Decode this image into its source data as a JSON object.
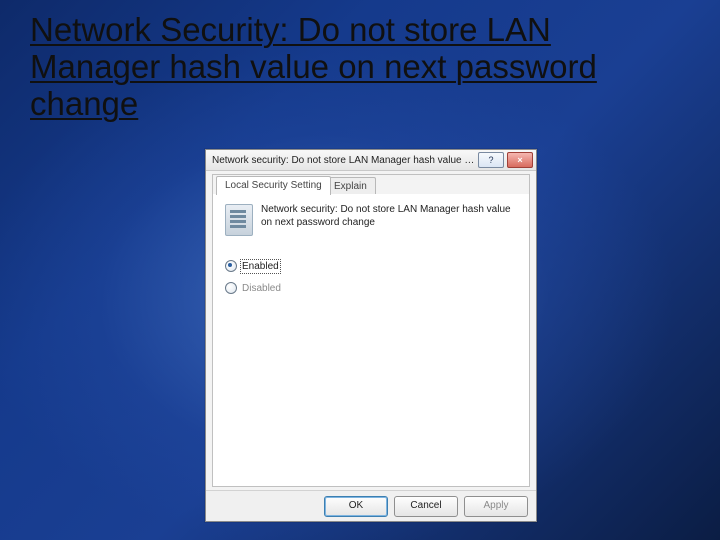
{
  "slide": {
    "title": "Network Security: Do not store LAN Manager hash value on next password change"
  },
  "dialog": {
    "titlebar": "Network security: Do not store LAN Manager hash value on ne…",
    "help_icon": "?",
    "close_icon": "×",
    "tabs": {
      "local": "Local Security Setting",
      "explain": "Explain"
    },
    "policy_description": "Network security: Do not store LAN Manager hash value on next password change",
    "options": {
      "enabled": "Enabled",
      "disabled": "Disabled"
    },
    "buttons": {
      "ok": "OK",
      "cancel": "Cancel",
      "apply": "Apply"
    }
  }
}
